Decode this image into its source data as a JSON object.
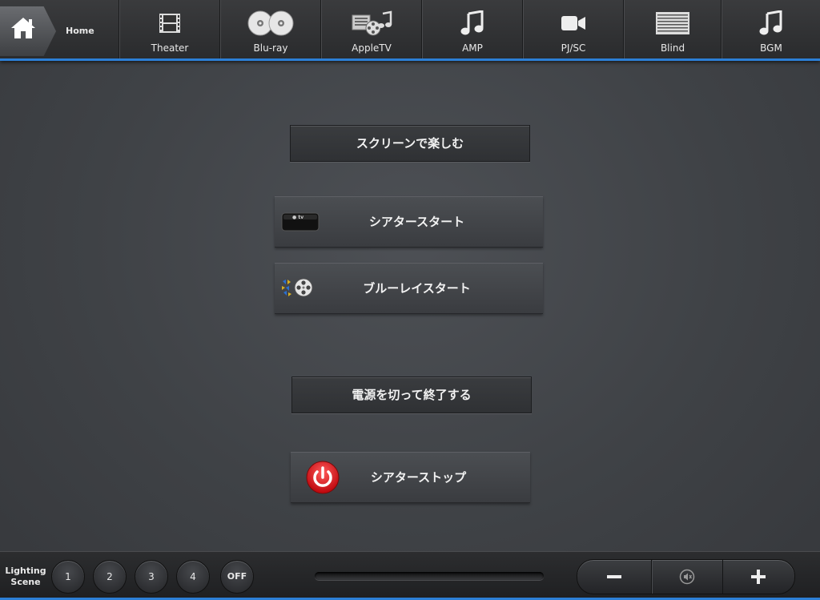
{
  "nav": {
    "home": {
      "label": "Home",
      "icon": "home-icon"
    },
    "items": [
      {
        "label": "Theater",
        "icon": "film-icon"
      },
      {
        "label": "Blu-ray",
        "icon": "discs-icon"
      },
      {
        "label": "AppleTV",
        "icon": "media-icon"
      },
      {
        "label": "AMP",
        "icon": "music-note-icon"
      },
      {
        "label": "PJ/SC",
        "icon": "video-camera-icon"
      },
      {
        "label": "Blind",
        "icon": "blinds-icon"
      },
      {
        "label": "BGM",
        "icon": "music-note-icon"
      }
    ],
    "accent_color": "#2c7fd6"
  },
  "main": {
    "enjoy_header": "スクリーンで楽しむ",
    "theater_start": {
      "label": "シアタースタート",
      "icon": "apple-tv-icon"
    },
    "bluray_start": {
      "label": "ブルーレイスタート",
      "icon": "bluray-film-icon"
    },
    "power_off_header": "電源を切って終了する",
    "theater_stop": {
      "label": "シアターストップ",
      "icon": "power-icon",
      "icon_color": "#e0151b"
    }
  },
  "bottom": {
    "lighting_label_line1": "Lighting",
    "lighting_label_line2": "Scene",
    "scenes": [
      "1",
      "2",
      "3",
      "4",
      "OFF"
    ],
    "volume": {
      "minus_icon": "minus-icon",
      "mute_icon": "mute-icon",
      "plus_icon": "plus-icon"
    }
  }
}
